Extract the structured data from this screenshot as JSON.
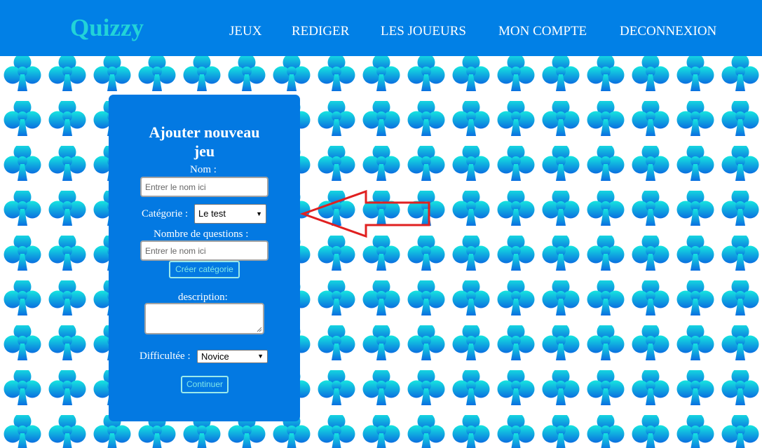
{
  "app": {
    "logo": "Quizzy"
  },
  "nav": {
    "items": [
      {
        "label": "JEUX"
      },
      {
        "label": "REDIGER"
      },
      {
        "label": "LES JOUEURS"
      },
      {
        "label": "MON COMPTE"
      },
      {
        "label": "DECONNEXION"
      }
    ]
  },
  "form": {
    "title": "Ajouter nouveau\njeu",
    "name_label": "Nom :",
    "name_placeholder": "Entrer le nom ici",
    "category_label": "Catégorie :",
    "category_value": "Le test",
    "questions_label": "Nombre de questions :",
    "questions_placeholder": "Entrer le nom ici",
    "create_category_button": "Créer catégorie",
    "description_label": "description:",
    "difficulty_label": "Difficultée :",
    "difficulty_value": "Novice",
    "continue_button": "Continuer"
  },
  "colors": {
    "navbar": "#0180e6",
    "logo": "#22d3d8",
    "panel": "#0379e2",
    "club_top": "#16e6e0",
    "club_bottom": "#0a6fe0",
    "arrow": "#e02020"
  }
}
